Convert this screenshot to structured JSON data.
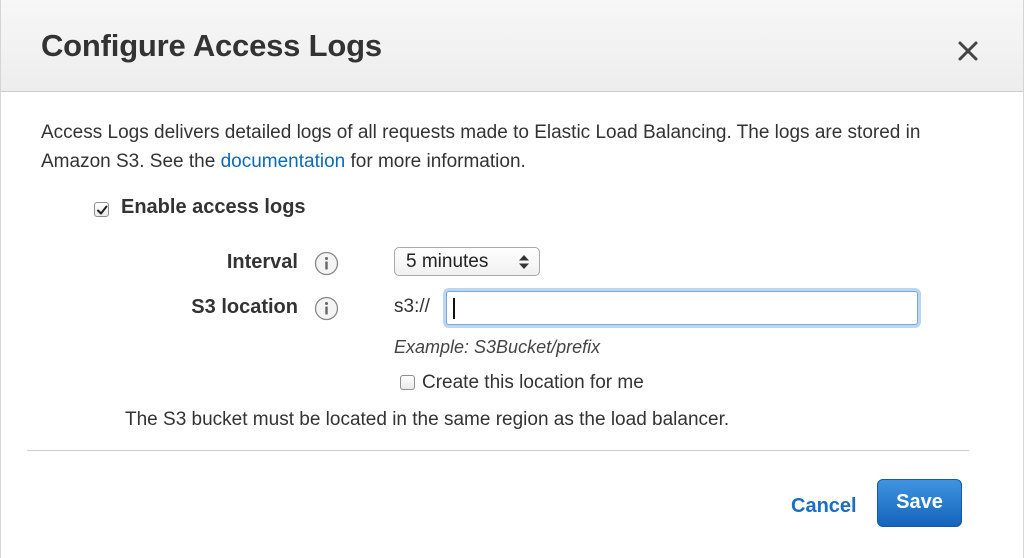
{
  "dialog": {
    "title": "Configure Access Logs",
    "close_icon": "close-icon"
  },
  "description": {
    "text_before": "Access Logs delivers detailed logs of all requests made to Elastic Load Balancing. The logs are stored in Amazon S3. See the ",
    "link_text": "documentation",
    "text_after": " for more information."
  },
  "enable": {
    "label": "Enable access logs",
    "checked": true
  },
  "interval": {
    "label": "Interval",
    "selected": "5 minutes",
    "info_icon": "info-icon"
  },
  "s3_location": {
    "label": "S3 location",
    "prefix": "s3://",
    "value": "",
    "example": "Example: S3Bucket/prefix",
    "info_icon": "info-icon"
  },
  "create_location": {
    "label": "Create this location for me",
    "checked": false
  },
  "note": "The S3 bucket must be located in the same region as the load balancer.",
  "footer": {
    "cancel_label": "Cancel",
    "save_label": "Save"
  },
  "colors": {
    "link": "#0b6ab8",
    "primary": "#1a6fc2",
    "focus": "#7aa7d9"
  }
}
